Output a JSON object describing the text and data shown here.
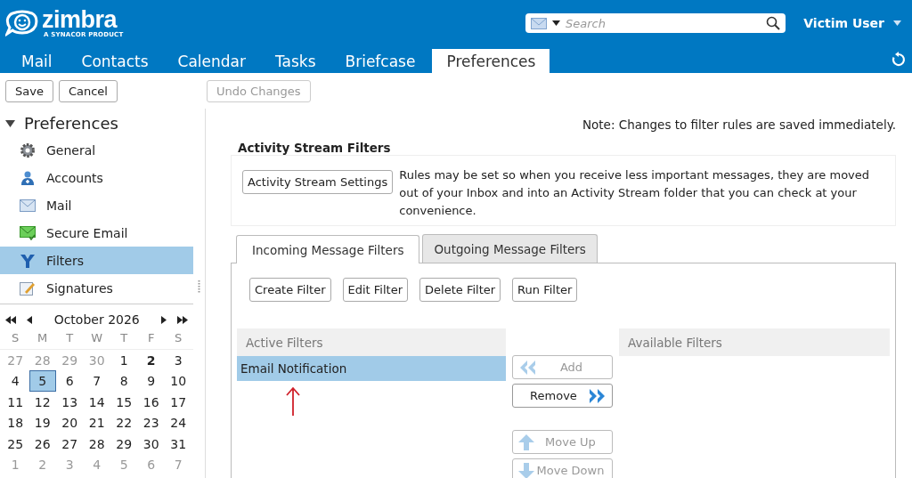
{
  "logo": {
    "name": "zimbra",
    "tagline": "A SYNACOR PRODUCT"
  },
  "search": {
    "placeholder": "Search"
  },
  "user": {
    "name": "Victim User"
  },
  "app_tabs": [
    {
      "label": "Mail",
      "selected": false
    },
    {
      "label": "Contacts",
      "selected": false
    },
    {
      "label": "Calendar",
      "selected": false
    },
    {
      "label": "Tasks",
      "selected": false
    },
    {
      "label": "Briefcase",
      "selected": false
    },
    {
      "label": "Preferences",
      "selected": true
    }
  ],
  "toolbar": [
    {
      "label": "Save",
      "disabled": false
    },
    {
      "label": "Cancel",
      "disabled": false
    },
    {
      "label": "Undo Changes",
      "disabled": true
    }
  ],
  "sidebar": {
    "title": "Preferences",
    "expanded": true,
    "items": [
      {
        "label": "General",
        "kind": "gear",
        "selected": false
      },
      {
        "label": "Accounts",
        "kind": "accounts",
        "selected": false
      },
      {
        "label": "Mail",
        "kind": "mail",
        "selected": false
      },
      {
        "label": "Secure Email",
        "kind": "secure",
        "selected": false
      },
      {
        "label": "Filters",
        "kind": "filter",
        "selected": true
      },
      {
        "label": "Signatures",
        "kind": "signature",
        "selected": false
      }
    ]
  },
  "calendar": {
    "month": "October 2026",
    "weekdays": [
      "S",
      "M",
      "T",
      "W",
      "T",
      "F",
      "S"
    ],
    "weeks": [
      [
        {
          "d": "27",
          "muted": true,
          "bold": false,
          "selected": false
        },
        {
          "d": "28",
          "muted": true,
          "bold": false,
          "selected": false
        },
        {
          "d": "29",
          "muted": true,
          "bold": false,
          "selected": false
        },
        {
          "d": "30",
          "muted": true,
          "bold": false,
          "selected": false
        },
        {
          "d": "1",
          "muted": false,
          "bold": false,
          "selected": false
        },
        {
          "d": "2",
          "muted": false,
          "bold": true,
          "selected": false
        },
        {
          "d": "3",
          "muted": false,
          "bold": false,
          "selected": false
        }
      ],
      [
        {
          "d": "4",
          "muted": false,
          "bold": false,
          "selected": false
        },
        {
          "d": "5",
          "muted": false,
          "bold": false,
          "selected": true
        },
        {
          "d": "6",
          "muted": false,
          "bold": false,
          "selected": false
        },
        {
          "d": "7",
          "muted": false,
          "bold": false,
          "selected": false
        },
        {
          "d": "8",
          "muted": false,
          "bold": false,
          "selected": false
        },
        {
          "d": "9",
          "muted": false,
          "bold": false,
          "selected": false
        },
        {
          "d": "10",
          "muted": false,
          "bold": false,
          "selected": false
        }
      ],
      [
        {
          "d": "11",
          "muted": false,
          "bold": false,
          "selected": false
        },
        {
          "d": "12",
          "muted": false,
          "bold": false,
          "selected": false
        },
        {
          "d": "13",
          "muted": false,
          "bold": false,
          "selected": false
        },
        {
          "d": "14",
          "muted": false,
          "bold": false,
          "selected": false
        },
        {
          "d": "15",
          "muted": false,
          "bold": false,
          "selected": false
        },
        {
          "d": "16",
          "muted": false,
          "bold": false,
          "selected": false
        },
        {
          "d": "17",
          "muted": false,
          "bold": false,
          "selected": false
        }
      ],
      [
        {
          "d": "18",
          "muted": false,
          "bold": false,
          "selected": false
        },
        {
          "d": "19",
          "muted": false,
          "bold": false,
          "selected": false
        },
        {
          "d": "20",
          "muted": false,
          "bold": false,
          "selected": false
        },
        {
          "d": "21",
          "muted": false,
          "bold": false,
          "selected": false
        },
        {
          "d": "22",
          "muted": false,
          "bold": false,
          "selected": false
        },
        {
          "d": "23",
          "muted": false,
          "bold": false,
          "selected": false
        },
        {
          "d": "24",
          "muted": false,
          "bold": false,
          "selected": false
        }
      ],
      [
        {
          "d": "25",
          "muted": false,
          "bold": false,
          "selected": false
        },
        {
          "d": "26",
          "muted": false,
          "bold": false,
          "selected": false
        },
        {
          "d": "27",
          "muted": false,
          "bold": false,
          "selected": false
        },
        {
          "d": "28",
          "muted": false,
          "bold": false,
          "selected": false
        },
        {
          "d": "29",
          "muted": false,
          "bold": false,
          "selected": false
        },
        {
          "d": "30",
          "muted": false,
          "bold": false,
          "selected": false
        },
        {
          "d": "31",
          "muted": false,
          "bold": false,
          "selected": false
        }
      ],
      [
        {
          "d": "1",
          "muted": true,
          "bold": false,
          "selected": false
        },
        {
          "d": "2",
          "muted": true,
          "bold": false,
          "selected": false
        },
        {
          "d": "3",
          "muted": true,
          "bold": false,
          "selected": false
        },
        {
          "d": "4",
          "muted": true,
          "bold": false,
          "selected": false
        },
        {
          "d": "5",
          "muted": true,
          "bold": false,
          "selected": false
        },
        {
          "d": "6",
          "muted": true,
          "bold": false,
          "selected": false
        },
        {
          "d": "7",
          "muted": true,
          "bold": false,
          "selected": false
        }
      ]
    ]
  },
  "note": "Note: Changes to filter rules are saved immediately.",
  "activity_stream": {
    "title": "Activity Stream Filters",
    "button": "Activity Stream Settings",
    "description": "Rules may be set so when you receive less important messages, they are moved out of your Inbox and into an Activity Stream folder that you can check at your convenience."
  },
  "filter_tabs": [
    {
      "label": "Incoming Message Filters",
      "selected": true
    },
    {
      "label": "Outgoing Message Filters",
      "selected": false
    }
  ],
  "filter_buttons": [
    "Create Filter",
    "Edit Filter",
    "Delete Filter",
    "Run Filter"
  ],
  "active_filters": {
    "title": "Active Filters",
    "items": [
      {
        "label": "Email Notification",
        "selected": true
      }
    ]
  },
  "move_buttons": [
    {
      "label": "Add",
      "kind": "add",
      "disabled": true
    },
    {
      "label": "Remove",
      "kind": "remove",
      "disabled": false
    },
    {
      "label": "Move Up",
      "kind": "up",
      "disabled": true
    },
    {
      "label": "Move Down",
      "kind": "down",
      "disabled": true
    }
  ],
  "available_filters": {
    "title": "Available Filters"
  }
}
